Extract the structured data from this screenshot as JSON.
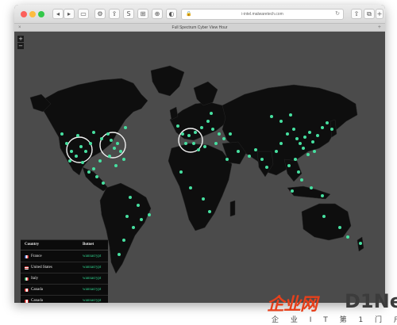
{
  "browser": {
    "url": "i-intel.malwaretech.com",
    "tab_title": "Full Spectrum Cyber View Hour",
    "toolbar_glyphs": [
      "◂",
      "▸",
      "▭",
      "⚙",
      "⇪",
      "S",
      "⊞",
      "⊕",
      "◐",
      "⊕"
    ],
    "right_glyphs": [
      "⇧",
      "⧉",
      "+"
    ]
  },
  "map": {
    "zoom_in_label": "+",
    "zoom_out_label": "−",
    "colors": {
      "ocean": "#4b4b4b",
      "land": "#0e0e0e",
      "marker": "#46e0a0",
      "highlight_ring": "#f2f2f2"
    }
  },
  "legend": {
    "headers": {
      "country": "Country",
      "botnet": "Botnet"
    },
    "rows": [
      {
        "country": "France",
        "botnet": "wannacrypt",
        "flag": "flag-icon"
      },
      {
        "country": "United States",
        "botnet": "wannacrypt",
        "flag": "flag-icon"
      },
      {
        "country": "Italy",
        "botnet": "wannacrypt",
        "flag": "flag-icon"
      },
      {
        "country": "Canada",
        "botnet": "wannacrypt",
        "flag": "flag-icon"
      },
      {
        "country": "Canada",
        "botnet": "wannacrypt",
        "flag": "flag-icon"
      }
    ]
  },
  "watermark": {
    "logo_text": "企业网",
    "brand": "D1Net",
    "subtitle": "企 业 I T 第 1 门 户"
  }
}
